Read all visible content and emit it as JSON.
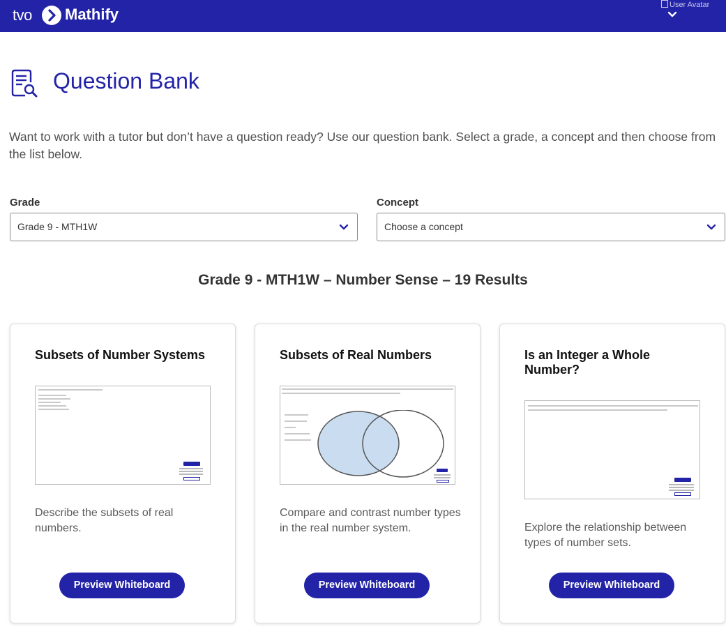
{
  "header": {
    "brand_prefix": "tvo",
    "brand_name": "Mathify",
    "avatar_alt": "User Avatar",
    "logo_icon": "tvo-play-circle-icon",
    "menu_icon": "chevron-down-icon"
  },
  "page": {
    "title": "Question Bank",
    "title_icon": "document-search-icon",
    "intro": "Want to work with a tutor but don’t have a question ready? Use our question bank. Select a grade, a concept and then choose from the list below."
  },
  "filters": {
    "grade": {
      "label": "Grade",
      "value": "Grade 9 - MTH1W"
    },
    "concept": {
      "label": "Concept",
      "value": "Choose a concept"
    }
  },
  "results": {
    "heading": "Grade 9 - MTH1W – Number Sense – 19 Results"
  },
  "cards": [
    {
      "title": "Subsets of Number Systems",
      "description": "Describe the subsets of real numbers.",
      "button": "Preview Whiteboard"
    },
    {
      "title": "Subsets of Real Numbers",
      "description": "Compare and contrast number types in the real number system.",
      "button": "Preview Whiteboard",
      "diagram_labels": [
        "Natural Numbers",
        "Whole Numbers",
        "Integers",
        "Rational Numbers",
        "Irrational Numbers"
      ]
    },
    {
      "title": "Is an Integer a Whole Number?",
      "description": "Explore the relationship between types of number sets.",
      "button": "Preview Whiteboard"
    }
  ],
  "colors": {
    "brand": "#2323a8",
    "venn_fill": "#c9dcf0"
  }
}
